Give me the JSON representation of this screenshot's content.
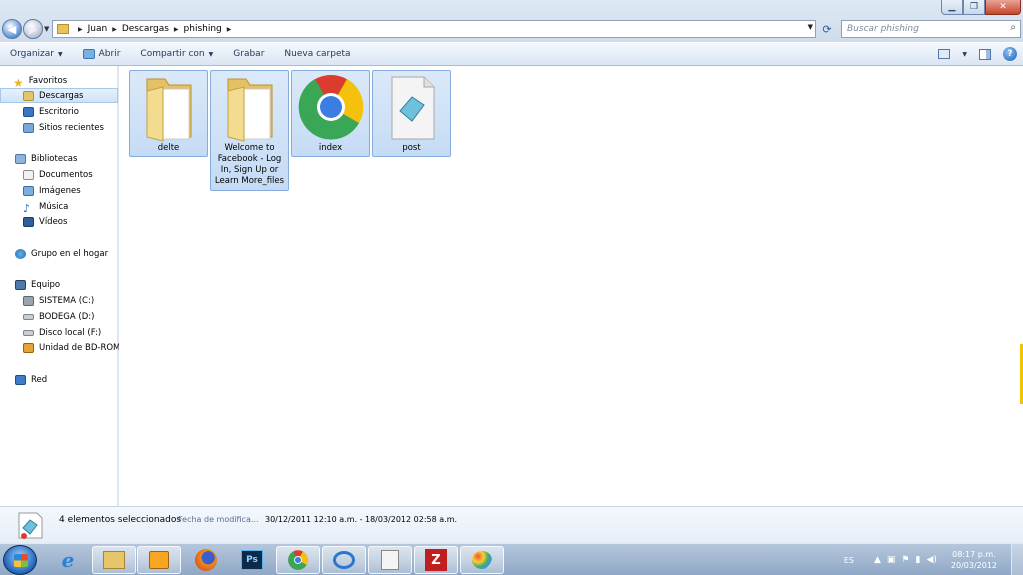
{
  "window": {
    "controls": {
      "minimize": "▁",
      "maximize": "❐",
      "close": "✕"
    }
  },
  "address": {
    "crumbs": [
      "Juan",
      "Descargas",
      "phishing"
    ],
    "search_placeholder": "Buscar phishing"
  },
  "toolbar": {
    "organize": "Organizar",
    "open": "Abrir",
    "share": "Compartir con",
    "burn": "Grabar",
    "new_folder": "Nueva carpeta"
  },
  "navpane": {
    "favorites": "Favoritos",
    "downloads": "Descargas",
    "desktop": "Escritorio",
    "recent": "Sitios recientes",
    "libraries": "Bibliotecas",
    "documents": "Documentos",
    "images": "Imágenes",
    "music": "Música",
    "videos": "Vídeos",
    "homegroup": "Grupo en el hogar",
    "computer": "Equipo",
    "drive_c": "SISTEMA (C:)",
    "drive_d": "BODEGA (D:)",
    "drive_f": "Disco local (F:)",
    "drive_bd": "Unidad de BD-ROM",
    "network": "Red"
  },
  "files": [
    {
      "name": "delte",
      "icon": "folder-icon"
    },
    {
      "name": "Welcome to Facebook - Log In, Sign Up or Learn More_files",
      "icon": "folder-icon"
    },
    {
      "name": "index",
      "icon": "chrome-icon"
    },
    {
      "name": "post",
      "icon": "document-icon"
    }
  ],
  "details": {
    "count": "4 elementos seleccionados",
    "date_label": "Fecha de modifica...",
    "date_value": "30/12/2011 12:10 a.m. - 18/03/2012 02:58 a.m."
  },
  "taskbar": {
    "lang": "ES",
    "time": "08:17 p.m.",
    "date": "20/03/2012",
    "ps_label": "Ps"
  }
}
